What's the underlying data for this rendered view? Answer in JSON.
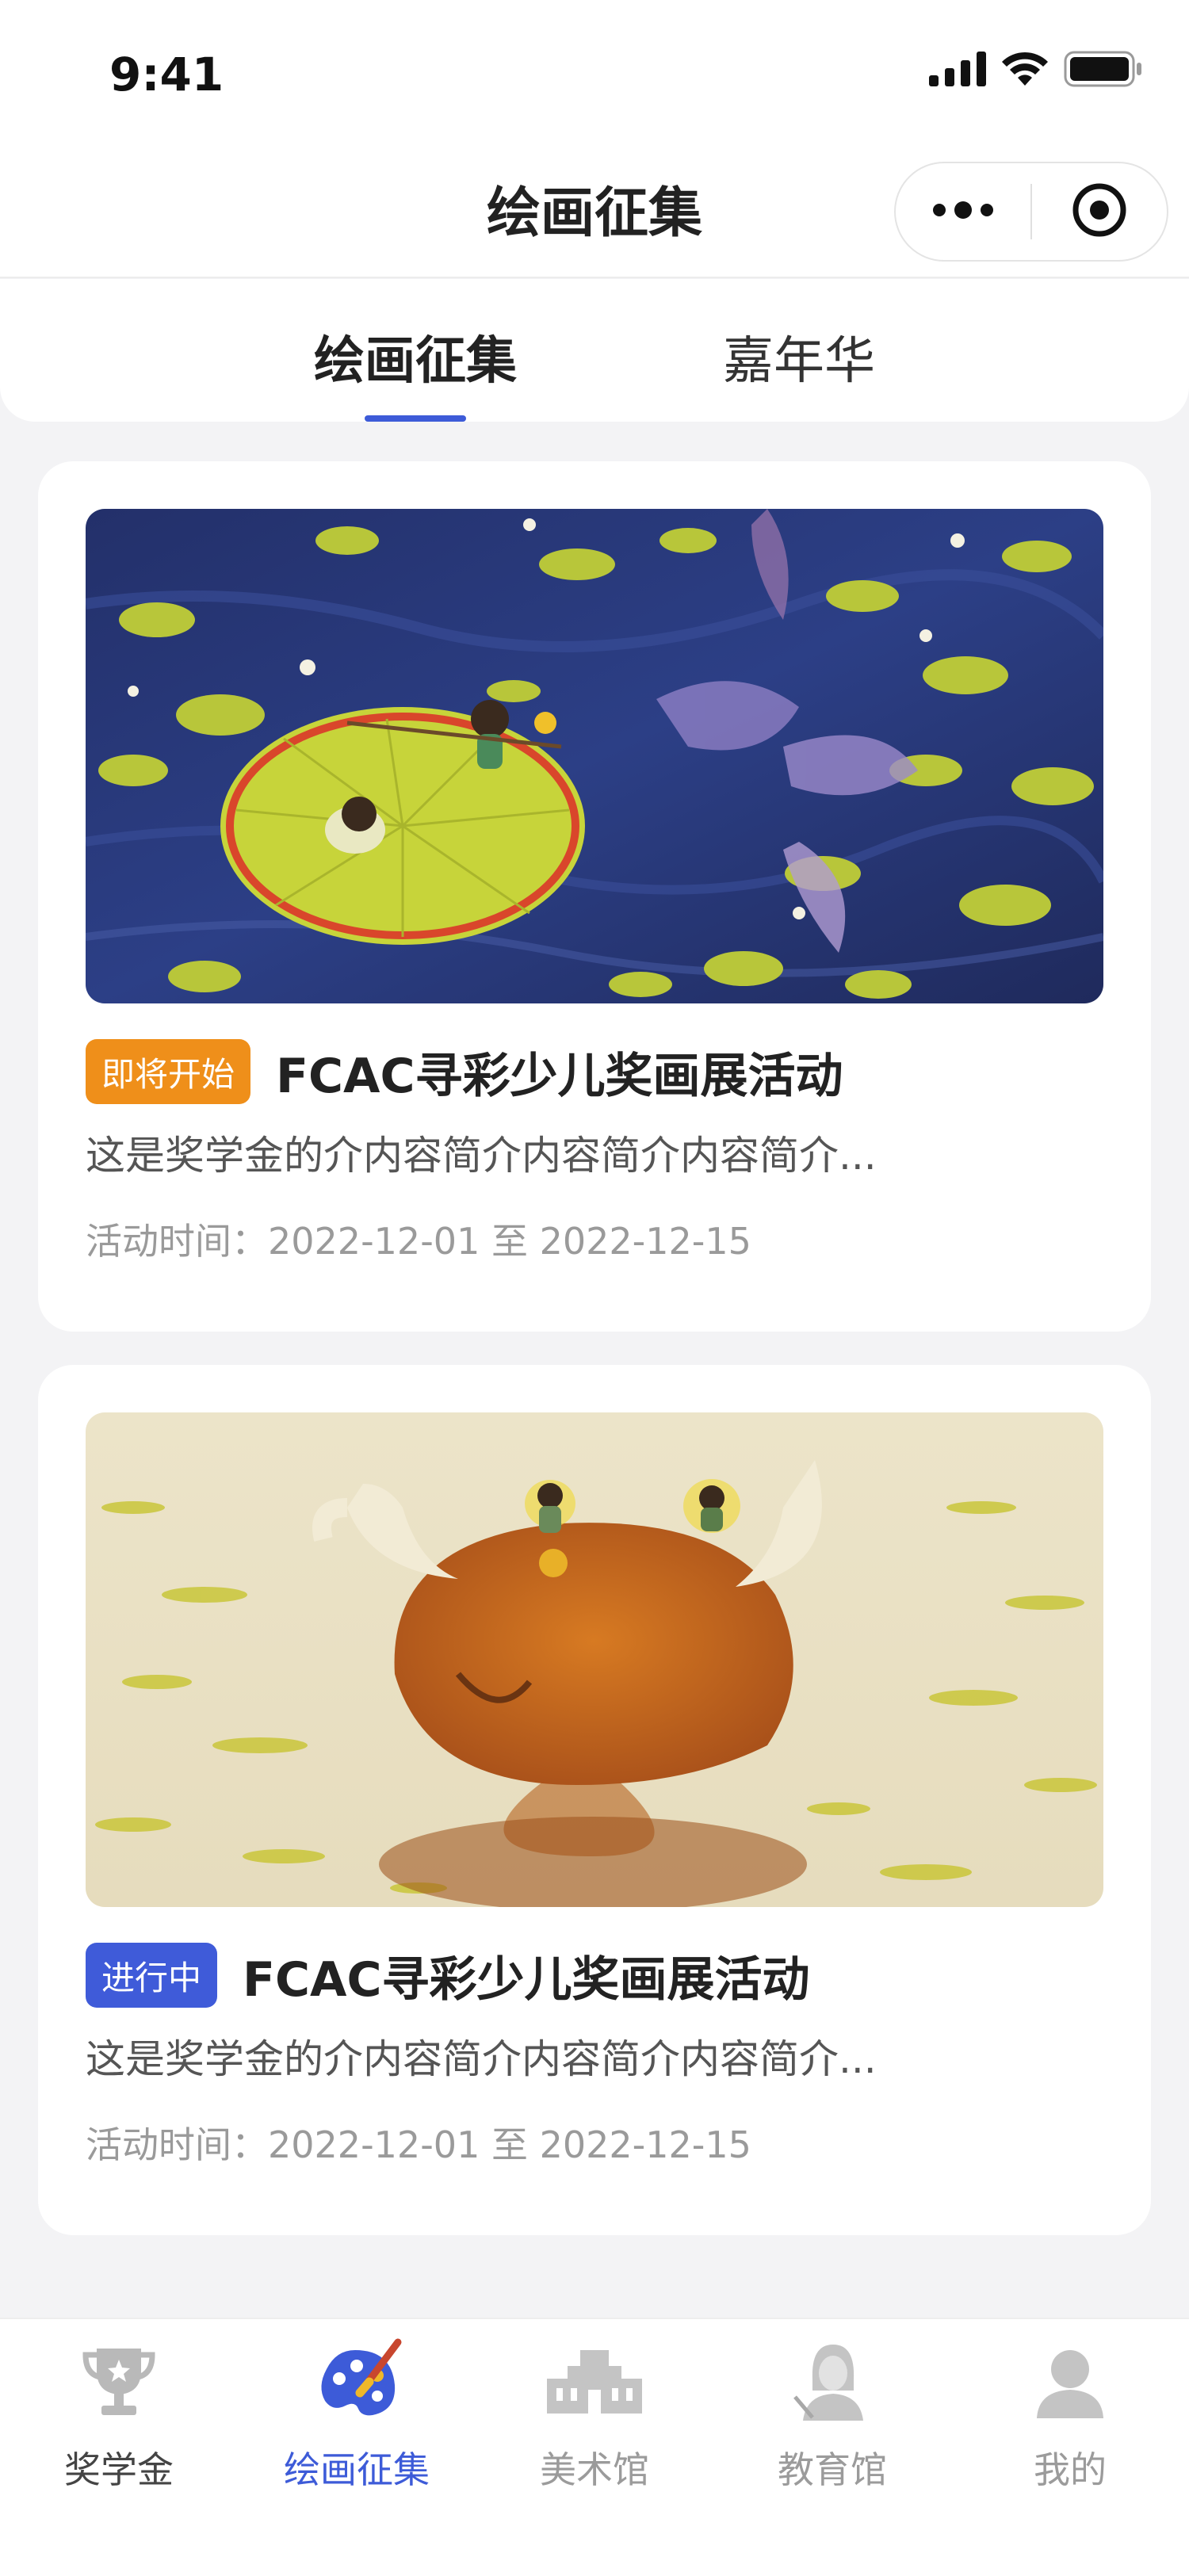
{
  "status_bar": {
    "time": "9:41",
    "icons": [
      "signal-icon",
      "wifi-icon",
      "battery-icon"
    ]
  },
  "nav": {
    "title": "绘画征集",
    "capsule_icons": [
      "more-icon",
      "target-icon"
    ]
  },
  "tabs": [
    {
      "label": "绘画征集",
      "active": true
    },
    {
      "label": "嘉年华",
      "active": false
    }
  ],
  "cards": [
    {
      "status": "即将开始",
      "status_color": "#ef8f1a",
      "title": "FCAC寻彩少儿奖画展活动",
      "desc": "这是奖学金的介内容简介内容简介内容简介...",
      "time": "活动时间：2022-12-01 至 2022-12-15"
    },
    {
      "status": "进行中",
      "status_color": "#3f5bd9",
      "title": "FCAC寻彩少儿奖画展活动",
      "desc": "这是奖学金的介内容简介内容简介内容简介...",
      "time": "活动时间：2022-12-01 至 2022-12-15"
    }
  ],
  "tabbar": [
    {
      "label": "奖学金",
      "icon": "trophy-icon",
      "active": false
    },
    {
      "label": "绘画征集",
      "icon": "palette-icon",
      "active": true
    },
    {
      "label": "美术馆",
      "icon": "museum-icon",
      "active": false
    },
    {
      "label": "教育馆",
      "icon": "teacher-icon",
      "active": false
    },
    {
      "label": "我的",
      "icon": "user-icon",
      "active": false
    }
  ],
  "colors": {
    "accent": "#3d5bd8",
    "upcoming": "#ef8f1a",
    "ongoing": "#3f5bd9",
    "background": "#f3f3f5"
  }
}
